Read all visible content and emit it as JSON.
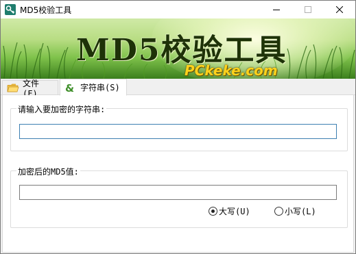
{
  "window": {
    "title": "MD5校验工具"
  },
  "banner": {
    "title": "MD5校验工具",
    "subtitle": "PCkeke.com"
  },
  "tabs": [
    {
      "label": "文件(F)",
      "icon": "folder-icon",
      "selected": false
    },
    {
      "label": "字符串(S)",
      "icon": "ampersand-icon",
      "selected": true
    }
  ],
  "input_group": {
    "label": "请输入要加密的字符串:",
    "value": ""
  },
  "output_group": {
    "label": "加密后的MD5值:",
    "value": ""
  },
  "case_options": {
    "options": [
      {
        "label": "大写(U)",
        "checked": true
      },
      {
        "label": "小写(L)",
        "checked": false
      }
    ]
  },
  "colors": {
    "accent": "#3c7fb1",
    "banner_green": "#7fc24b",
    "banner_text": "#1e3208",
    "banner_subtitle": "#ffd21c"
  }
}
